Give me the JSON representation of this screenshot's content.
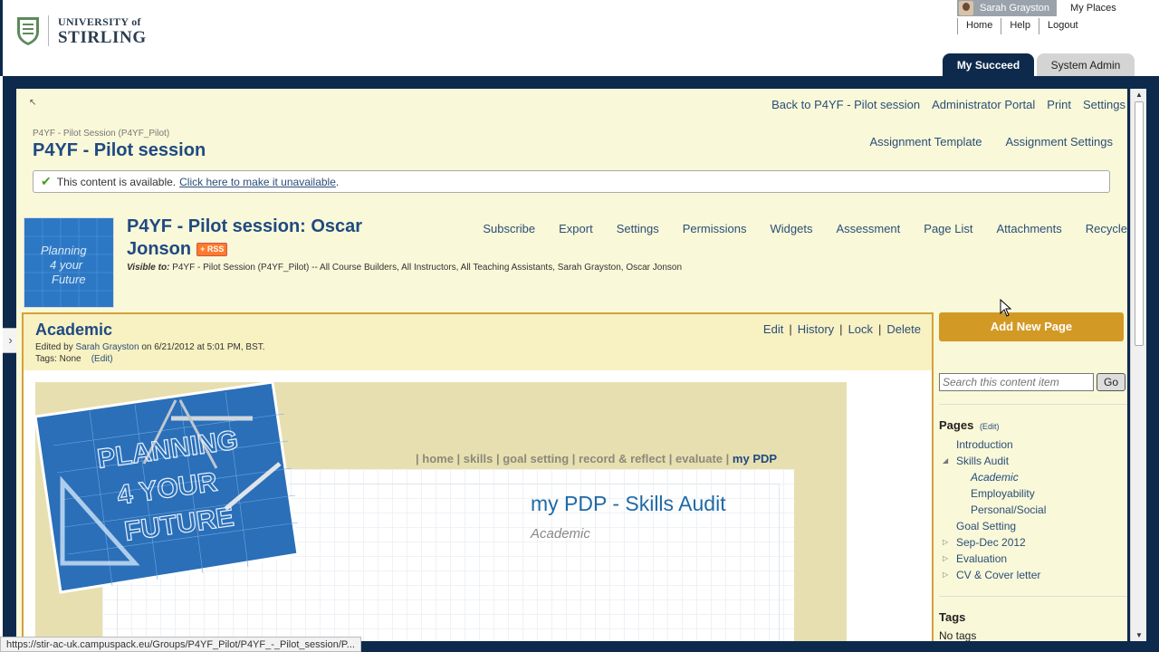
{
  "header": {
    "logo_top": "UNIVERSITY of",
    "logo_bottom": "STIRLING",
    "user_name": "Sarah Grayston",
    "my_places": "My Places",
    "links": [
      "Home",
      "Help",
      "Logout"
    ],
    "tabs": [
      {
        "label": "My Succeed",
        "active": true
      },
      {
        "label": "System Admin",
        "active": false
      }
    ]
  },
  "nav_top": [
    "Back to P4YF - Pilot session",
    "Administrator Portal",
    "Print",
    "Settings"
  ],
  "breadcrumb": "P4YF - Pilot Session (P4YF_Pilot)",
  "session_title": "P4YF - Pilot session",
  "assignment_links": [
    "Assignment Template",
    "Assignment Settings"
  ],
  "availability": {
    "text": "This content is available.",
    "link": "Click here to make it unavailable",
    "end": "."
  },
  "blog": {
    "title": "P4YF - Pilot session: Oscar Jonson",
    "rss_label": "RSS",
    "visible_label": "Visible to:",
    "visible_to": "P4YF - Pilot Session (P4YF_Pilot) -- All Course Builders, All Instructors, All Teaching Assistants, Sarah Grayston, Oscar Jonson",
    "nav": [
      "Subscribe",
      "Export",
      "Settings",
      "Permissions",
      "Widgets",
      "Assessment",
      "Page List",
      "Attachments",
      "Recycle"
    ],
    "thumb_lines": [
      "Planning",
      "4 your",
      "Future"
    ]
  },
  "page": {
    "name": "Academic",
    "edited_prefix": "Edited by",
    "edited_by": "Sarah Grayston",
    "edited_suffix": "on 6/21/2012 at 5:01 PM, BST.",
    "tags_label": "Tags: None",
    "tags_edit": "(Edit)",
    "actions": [
      "Edit",
      "History",
      "Lock",
      "Delete"
    ]
  },
  "banner": {
    "art_lines": [
      "PLANNING",
      "4 YOUR",
      "FUTURE"
    ],
    "nav": [
      "home",
      "skills",
      "goal setting",
      "record & reflect",
      "evaluate"
    ],
    "nav_current": "my PDP",
    "title": "my PDP - Skills Audit",
    "subtitle": "Academic"
  },
  "sidebar": {
    "add_page": "Add New Page",
    "search_placeholder": "Search this content item",
    "search_go": "Go",
    "pages_heading": "Pages",
    "pages_edit": "(Edit)",
    "pages": [
      {
        "label": "Introduction",
        "level": 0,
        "tri": ""
      },
      {
        "label": "Skills Audit",
        "level": 0,
        "tri": "expanded"
      },
      {
        "label": "Academic",
        "level": 1,
        "tri": "",
        "current": true
      },
      {
        "label": "Employability",
        "level": 1,
        "tri": ""
      },
      {
        "label": "Personal/Social",
        "level": 1,
        "tri": ""
      },
      {
        "label": "Goal Setting",
        "level": 0,
        "tri": ""
      },
      {
        "label": "Sep-Dec 2012",
        "level": 0,
        "tri": "collapsed"
      },
      {
        "label": "Evaluation",
        "level": 0,
        "tri": "collapsed"
      },
      {
        "label": "CV & Cover letter",
        "level": 0,
        "tri": "collapsed"
      }
    ],
    "tags_heading": "Tags",
    "no_tags": "No tags"
  },
  "status_url": "https://stir-ac-uk.campuspack.eu/Groups/P4YF_Pilot/P4YF_-_Pilot_session/P...",
  "colors": {
    "navy": "#0d2a4d",
    "link": "#2b4e78",
    "title": "#1f4a82",
    "accent_gold": "#d29a25",
    "page_bg": "#f9f8d8"
  }
}
